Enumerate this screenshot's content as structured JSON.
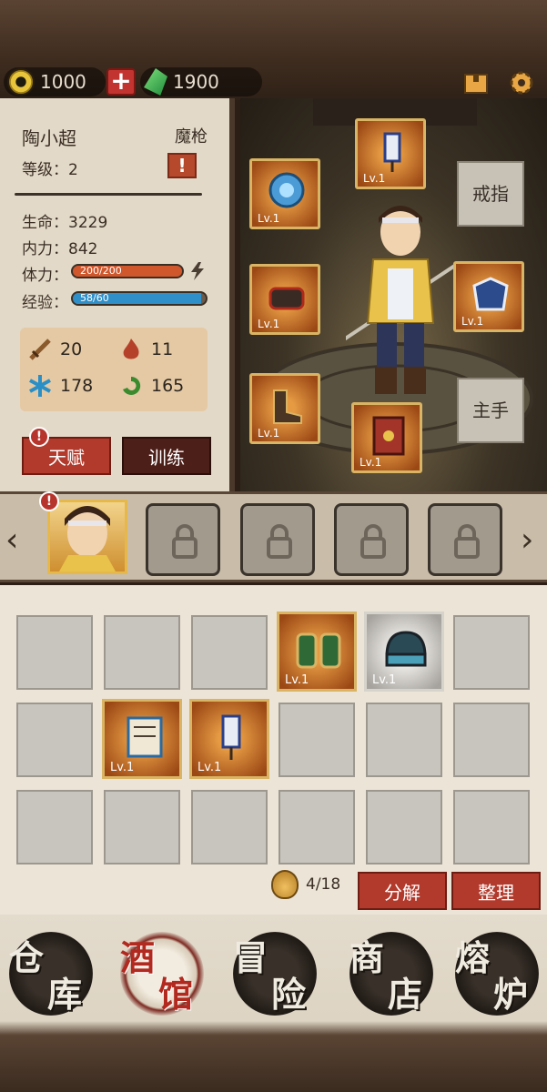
{
  "currencies": {
    "gold": "1000",
    "jade": "1900"
  },
  "hero": {
    "name": "陶小超",
    "class": "魔枪",
    "level_label": "等级：2",
    "alert": "!",
    "stats": {
      "hp_label": "生命：",
      "hp_value": "3229",
      "mp_label": "内力：",
      "mp_value": "842",
      "stamina_label": "体力：",
      "stamina_text": "200/200",
      "stamina_fraction": 1.0,
      "exp_label": "经验：",
      "exp_text": "58/60",
      "exp_fraction": 0.967
    },
    "attributes": {
      "attack": "20",
      "fire": "11",
      "ice": "178",
      "wind": "165"
    },
    "buttons": {
      "talent": "天赋",
      "train": "训练"
    }
  },
  "equipment": {
    "slots": [
      {
        "name": "amulet",
        "lv": "Lv.1"
      },
      {
        "name": "banner",
        "lv": "Lv.1"
      },
      {
        "name": "gauntlet",
        "lv": "Lv.1"
      },
      {
        "name": "armor",
        "lv": "Lv.1"
      },
      {
        "name": "boots",
        "lv": "Lv.1"
      },
      {
        "name": "book",
        "lv": "Lv.1"
      }
    ],
    "empty_ring": "戒指",
    "empty_mainhand": "主手"
  },
  "selector": {
    "left_arrow": "‹",
    "right_arrow": "›",
    "thumb_alert": "!"
  },
  "inventory": {
    "items": [
      {
        "name": "green-gauntlets",
        "lv": "Lv.1"
      },
      {
        "name": "helmet",
        "lv": "Lv.1"
      },
      {
        "name": "scroll",
        "lv": "Lv.1"
      },
      {
        "name": "banner",
        "lv": "Lv.1"
      }
    ],
    "capacity": "4/18",
    "decompose": "分解",
    "sort": "整理"
  },
  "nav": [
    {
      "c1": "仓",
      "c2": "库"
    },
    {
      "c1": "酒",
      "c2": "馆"
    },
    {
      "c1": "冒",
      "c2": "险"
    },
    {
      "c1": "商",
      "c2": "店"
    },
    {
      "c1": "熔",
      "c2": "炉"
    }
  ],
  "colors": {
    "accent_red": "#b13a2c",
    "stamina_bar": "#d0562c",
    "exp_bar": "#2f8fc8",
    "gold_frame": "#d9b464"
  }
}
